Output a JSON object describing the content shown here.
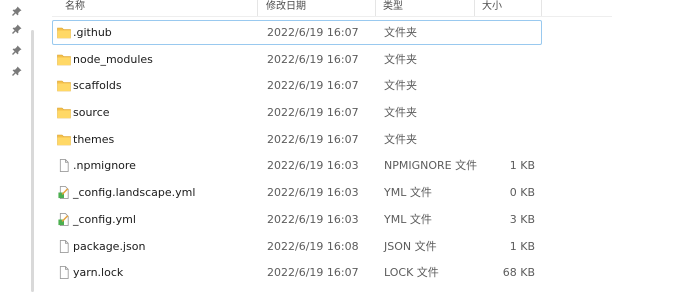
{
  "header": {
    "name": "名称",
    "modified": "修改日期",
    "type": "类型",
    "size": "大小"
  },
  "rows": [
    {
      "name": ".github",
      "modified": "2022/6/19 16:07",
      "type": "文件夹",
      "size": "",
      "icon": "folder-icon"
    },
    {
      "name": "node_modules",
      "modified": "2022/6/19 16:07",
      "type": "文件夹",
      "size": "",
      "icon": "folder-icon"
    },
    {
      "name": "scaffolds",
      "modified": "2022/6/19 16:07",
      "type": "文件夹",
      "size": "",
      "icon": "folder-icon"
    },
    {
      "name": "source",
      "modified": "2022/6/19 16:07",
      "type": "文件夹",
      "size": "",
      "icon": "folder-icon"
    },
    {
      "name": "themes",
      "modified": "2022/6/19 16:07",
      "type": "文件夹",
      "size": "",
      "icon": "folder-icon"
    },
    {
      "name": ".npmignore",
      "modified": "2022/6/19 16:03",
      "type": "NPMIGNORE 文件",
      "size": "1 KB",
      "icon": "file-icon"
    },
    {
      "name": "_config.landscape.yml",
      "modified": "2022/6/19 16:03",
      "type": "YML 文件",
      "size": "0 KB",
      "icon": "yml-file-icon"
    },
    {
      "name": "_config.yml",
      "modified": "2022/6/19 16:03",
      "type": "YML 文件",
      "size": "3 KB",
      "icon": "yml-file-icon"
    },
    {
      "name": "package.json",
      "modified": "2022/6/19 16:08",
      "type": "JSON 文件",
      "size": "1 KB",
      "icon": "file-icon"
    },
    {
      "name": "yarn.lock",
      "modified": "2022/6/19 16:07",
      "type": "LOCK 文件",
      "size": "68 KB",
      "icon": "file-icon"
    }
  ],
  "colors": {
    "folder": "#f5c04a",
    "focus_border": "#99c9ef",
    "pin": "#7a7a7a"
  }
}
